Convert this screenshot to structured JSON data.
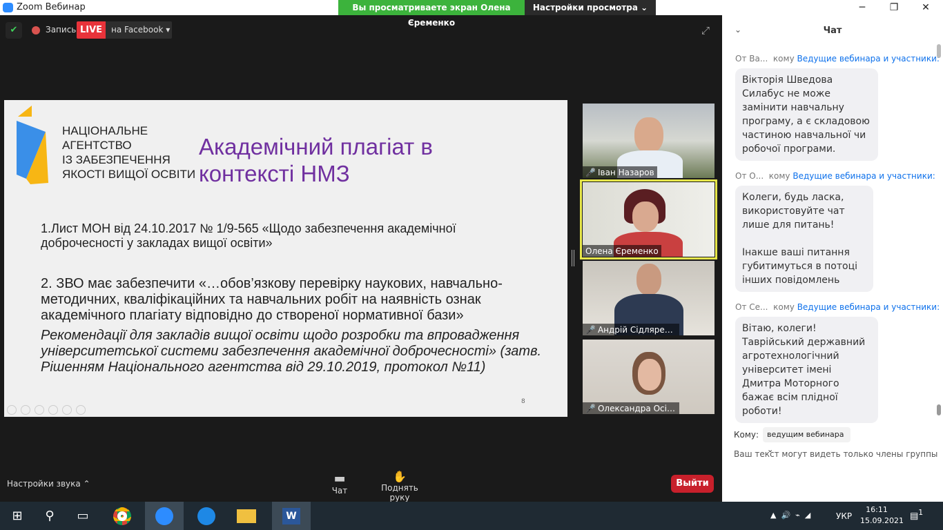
{
  "window": {
    "title": "Zoom Вебинар",
    "banner": "Вы просматриваете экран Олена Єременко",
    "view_settings": "Настройки просмотра ⌄",
    "minimize": "─",
    "maximize": "❐",
    "close": "✕"
  },
  "topbar": {
    "record": "Запись",
    "live": "LIVE",
    "live_target": "на Facebook ▾"
  },
  "slide": {
    "org": [
      "НАЦІОНАЛЬНЕ",
      "АГЕНТСТВО",
      "ІЗ ЗАБЕЗПЕЧЕННЯ",
      "ЯКОСТІ ВИЩОЇ ОСВІТИ"
    ],
    "title_line1": "Академічний плагіат в",
    "title_line2": "контексті НМЗ",
    "p1": "1.Лист МОН від 24.10.2017 № 1/9-565 «Щодо забезпечення академічної доброчесності у закладах вищої освіти»",
    "p2": "2. ЗВО має забезпечити «…обов’язкову перевірку наукових, навчально-методичних, кваліфікаційних та навчальних робіт на наявність ознак академічного плагіату відповідно до створеної нормативної бази»",
    "p3": "Рекомендації для закладів вищої освіти щодо розробки та впровадження університетської системи забезпечення академічної доброчесності» (затв. Рішенням Національного агентства від 29.10.2019, протокол №11)",
    "page": "8"
  },
  "participants": [
    {
      "name": "Іван Назаров"
    },
    {
      "name": "Олена Єременко"
    },
    {
      "name": "Андрій Сідляренко"
    },
    {
      "name": "Олександра Осіпова"
    }
  ],
  "toolbar": {
    "audio": "Настройки звука ⌃",
    "chat": "Чат",
    "raise_hand": "Поднять руку",
    "exit": "Выйти"
  },
  "chat": {
    "title": "Чат",
    "messages": [
      {
        "from": "От Ва...",
        "to_label": "кому",
        "to": "Ведущие вебинара и участники:",
        "text": "Вікторія Шведова Силабус не може замінити навчальну програму, а є складовою частиною навчальної чи робочої програми."
      },
      {
        "from": "От О...",
        "to_label": "кому",
        "to": "Ведущие вебинара и участники:",
        "text": "Колеги, будь ласка, використовуйте чат лише для питань!\n\nІнакше ваші питання губитимуться в потоці інших повідомлень"
      },
      {
        "from": "От Се...",
        "to_label": "кому",
        "to": "Ведущие вебинара и участники:",
        "text": "Вітаю, колеги! Таврійський державний агротехнологічний університет імені Дмитра Моторного бажає всім плідної роботи!"
      }
    ],
    "to_label": "Кому:",
    "to_value": "ведущим вебинара ⌄",
    "note": "Ваш текст могут видеть только члены группы"
  },
  "taskbar": {
    "lang": "УКР",
    "time": "16:11",
    "date": "15.09.2021",
    "notifications": "1"
  }
}
